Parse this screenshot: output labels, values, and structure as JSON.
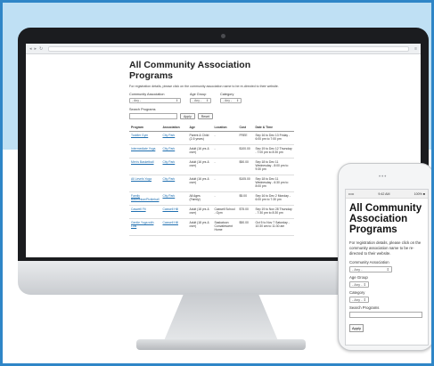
{
  "desktop": {
    "title": "All Community Association Programs",
    "intro": "For registration details, please click on the community association name to be re-directed to their website.",
    "filters": [
      {
        "label": "Community Association",
        "value": "- Any -"
      },
      {
        "label": "Age Group",
        "value": "- Any -"
      },
      {
        "label": "Category",
        "value": "- Any -"
      }
    ],
    "search_label": "Search Programs",
    "apply_label": "Apply",
    "reset_label": "Reset",
    "columns": [
      "Program",
      "Association",
      "Age",
      "Location",
      "Cost",
      "Date & Time"
    ],
    "rows": [
      [
        "Toddler Gym",
        "City Park",
        "Parent & Child (2-5 years)",
        "-",
        "FREE",
        "Sep 16 to Dec 13 Friday - 6:00 pm to 7:00 pm"
      ],
      [
        "Intermediate Yoga",
        "City Park",
        "Adult (16 yrs & over)",
        "-",
        "$100.00",
        "Sep 19 to Dec 12 Thursday - 7:00 pm to 8:30 pm"
      ],
      [
        "Men's Basketball",
        "City Park",
        "Adult (16 yrs & over)",
        "-",
        "$50.00",
        "Sep 18 to Dec 11 Wednesday - 8:00 pm to 9:30 pm"
      ],
      [
        "All Levels Yoga",
        "City Park",
        "Adult (16 yrs & over)",
        "-",
        "$105.00",
        "Sep 18 to Dec 11 Wednesday - 6:30 pm to 8:00 pm"
      ],
      [
        "Family Badminton/Pickleball",
        "City Park",
        "All Ages (Family)",
        "-",
        "$5.00",
        "Sep 16 to Dec 2 Monday - 6:00 pm to 7:30 pm"
      ],
      [
        "Caswell Fit",
        "Caswell Hill",
        "Adult (18 yrs & over)",
        "Caswell School - Gym",
        "$75.00",
        "Sep 19 to Nov 28 Thursday - 7:30 pm to 8:30 pm"
      ],
      [
        "Gentle Yoga with Lois",
        "Caswell Hill",
        "Adult (18 yrs & over)",
        "Saskatoon Convalescent Home",
        "$50.00",
        "Oct 5 to Nov 7 Saturday - 10:30 am to 11:30 am"
      ]
    ]
  },
  "mobile": {
    "status_left": "•••••",
    "status_time": "9:42 AM",
    "status_right": "100% ■",
    "title": "All Community Association Programs",
    "intro": "For registration details, please click on the community association name to be re-directed to their website.",
    "filters": [
      {
        "label": "Community Association",
        "value": "- Any -"
      },
      {
        "label": "Age Group",
        "value": "- Any -"
      },
      {
        "label": "Category",
        "value": "- Any -"
      }
    ],
    "search_label": "Search Programs",
    "apply_label": "Apply"
  },
  "colors": {
    "accent": "#2f86c7",
    "background_band": "#bfe0f4",
    "link": "#1f6fb0"
  }
}
